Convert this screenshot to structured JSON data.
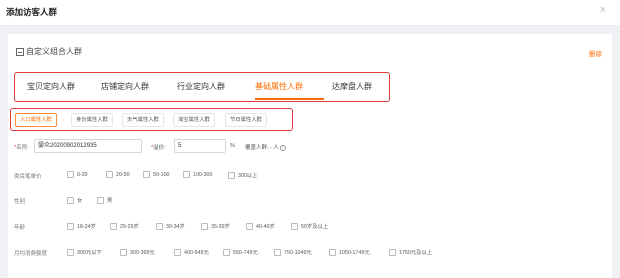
{
  "modal": {
    "title": "添加访客人群",
    "close": "×"
  },
  "panel": {
    "title": "自定义组合人群",
    "delete_label": "删除"
  },
  "tabs": [
    "宝贝定向人群",
    "店铺定向人群",
    "行业定向人群",
    "基础属性人群",
    "达摩盘人群"
  ],
  "active_tab": "基础属性人群",
  "subtabs": [
    "人口属性人群",
    "身份属性人群",
    "天气属性人群",
    "淘宝属性人群",
    "节日属性人群"
  ],
  "active_subtab": "人口属性人群",
  "form": {
    "name_label": "名称:",
    "name_value": "婴众20200902012935",
    "bid_label": "溢价:",
    "bid_value": "5",
    "percent": "%",
    "audience_label": "覆盖人群: - 人"
  },
  "rows": [
    {
      "label": "类目笔单价",
      "options": [
        "0-20",
        "20-50",
        "50-100",
        "100-300",
        "300以上"
      ]
    },
    {
      "label": "性别",
      "options": [
        "女",
        "男"
      ]
    },
    {
      "label": "年龄",
      "options": [
        "18-24岁",
        "25-29岁",
        "30-34岁",
        "35-39岁",
        "40-49岁",
        "50岁及以上"
      ]
    },
    {
      "label": "月均消费额度",
      "options": [
        "300元以下",
        "300-399元",
        "400-549元",
        "550-749元",
        "750-1049元",
        "1050-1749元",
        "1750元及以上"
      ]
    }
  ],
  "colors": {
    "accent": "#ff6a00",
    "highlight_border": "#e03b3b"
  }
}
